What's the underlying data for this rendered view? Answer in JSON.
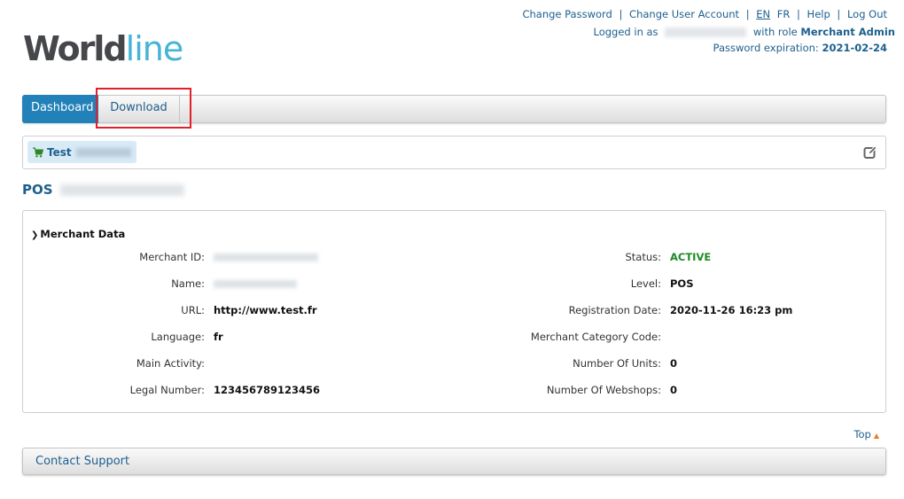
{
  "header": {
    "links": [
      {
        "label": "Change Password"
      },
      {
        "label": "Change User Account"
      },
      {
        "label": "EN",
        "current": true
      },
      {
        "label": "FR"
      },
      {
        "label": "Help"
      },
      {
        "label": "Log Out"
      }
    ],
    "logged_in_prefix": "Logged in as",
    "with_role_text": "with role",
    "role": "Merchant Admin",
    "password_expiration_label": "Password expiration:",
    "password_expiration_date": "2021-02-24"
  },
  "logo": {
    "part1": "World",
    "part2": "line"
  },
  "tabs": [
    {
      "label": "Dashboard",
      "active": true
    },
    {
      "label": "Download",
      "active": false
    }
  ],
  "breadcrumb": {
    "label": "Test",
    "icon": "shopping-cart-icon"
  },
  "page_title": {
    "prefix": "POS"
  },
  "merchant_data": {
    "title": "Merchant Data",
    "left_fields": [
      {
        "label": "Merchant ID:",
        "value": null,
        "redacted": true
      },
      {
        "label": "Name:",
        "value": null,
        "redacted": true
      },
      {
        "label": "URL:",
        "value": "http://www.test.fr"
      },
      {
        "label": "Language:",
        "value": "fr"
      },
      {
        "label": "Main Activity:",
        "value": ""
      },
      {
        "label": "Legal Number:",
        "value": "123456789123456"
      }
    ],
    "right_fields": [
      {
        "label": "Status:",
        "value": "ACTIVE"
      },
      {
        "label": "Level:",
        "value": "POS"
      },
      {
        "label": "Registration Date:",
        "value": "2020-11-26 16:23 pm"
      },
      {
        "label": "Merchant Category Code:",
        "value": ""
      },
      {
        "label": "Number Of Units:",
        "value": "0"
      },
      {
        "label": "Number Of Webshops:",
        "value": "0"
      }
    ]
  },
  "top_link": {
    "label": "Top"
  },
  "contact_support": {
    "label": "Contact Support"
  },
  "colors": {
    "brand_blue": "#2181b8",
    "link": "#1e5f8e",
    "active_status": "#1e8a26",
    "highlight": "#e2202a",
    "accent_orange": "#f07b1d"
  }
}
